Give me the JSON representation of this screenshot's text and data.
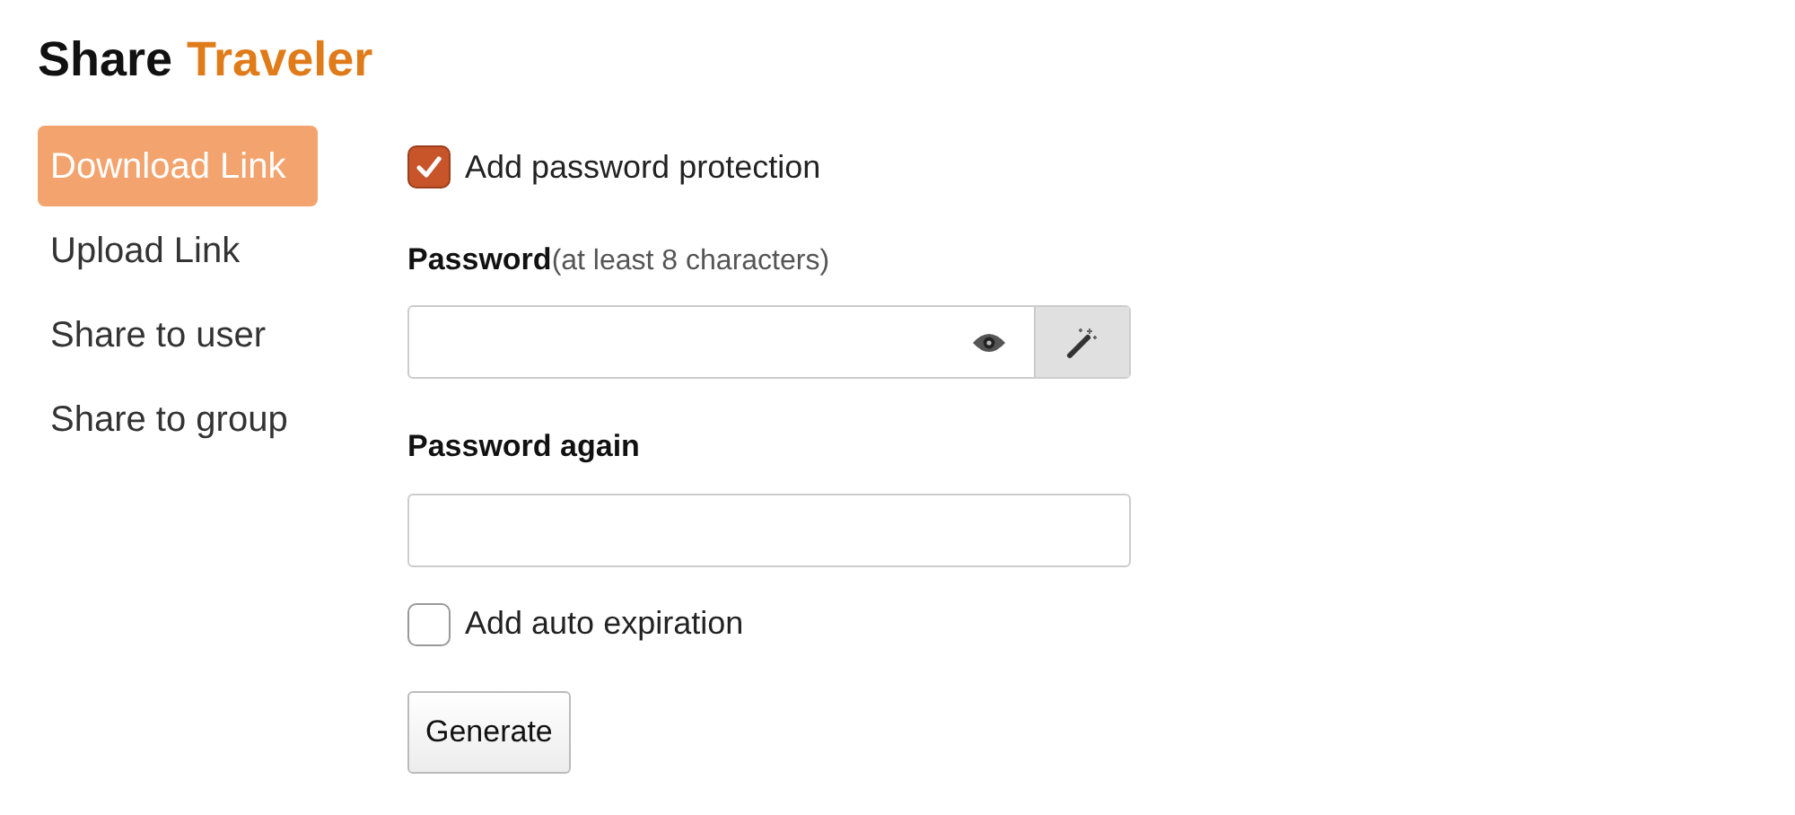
{
  "title": {
    "part_1": "Share",
    "part_2": "Traveler"
  },
  "nav": [
    {
      "label": "Download Link",
      "selected": true
    },
    {
      "label": "Upload Link",
      "selected": false
    },
    {
      "label": "Share to user",
      "selected": false
    },
    {
      "label": "Share to group",
      "selected": false
    }
  ],
  "password_protection": {
    "label": "Add password protection",
    "checked": true
  },
  "password": {
    "label": "Password",
    "hint": "(at least 8 characters)"
  },
  "password_again": {
    "label": "Password again"
  },
  "auto_expiration": {
    "label": "Add auto expiration",
    "checked": false
  },
  "generate_button": "Generate"
}
